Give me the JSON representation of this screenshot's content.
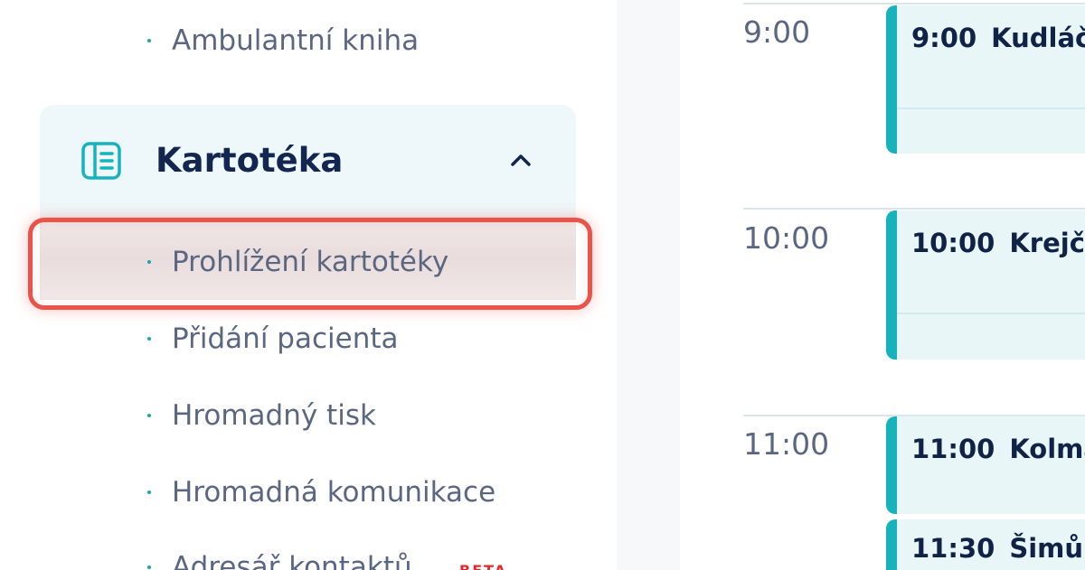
{
  "sidebar": {
    "items_above": [
      {
        "label": "Ambulantní kniha"
      }
    ],
    "group": {
      "title": "Kartotéka",
      "expanded": true,
      "icon": "card-file-icon"
    },
    "subitems": [
      {
        "label": "Prohlížení kartotéky",
        "selected": true
      },
      {
        "label": "Přidání pacienta"
      },
      {
        "label": "Hromadný tisk"
      },
      {
        "label": "Hromadná komunikace"
      },
      {
        "label": "Adresář kontaktů",
        "badge": "BETA"
      }
    ]
  },
  "calendar": {
    "hours": [
      "9:00",
      "10:00",
      "11:00"
    ],
    "events": [
      {
        "time": "9:00",
        "name": "Kudláč"
      },
      {
        "time": "10:00",
        "name": "Krejčí"
      },
      {
        "time": "11:00",
        "name": "Kolma"
      },
      {
        "time": "11:30",
        "name": "Šimůns"
      }
    ]
  },
  "colors": {
    "accent": "#17b3bd",
    "highlight": "#e8534a",
    "badge": "#e02b2b"
  }
}
